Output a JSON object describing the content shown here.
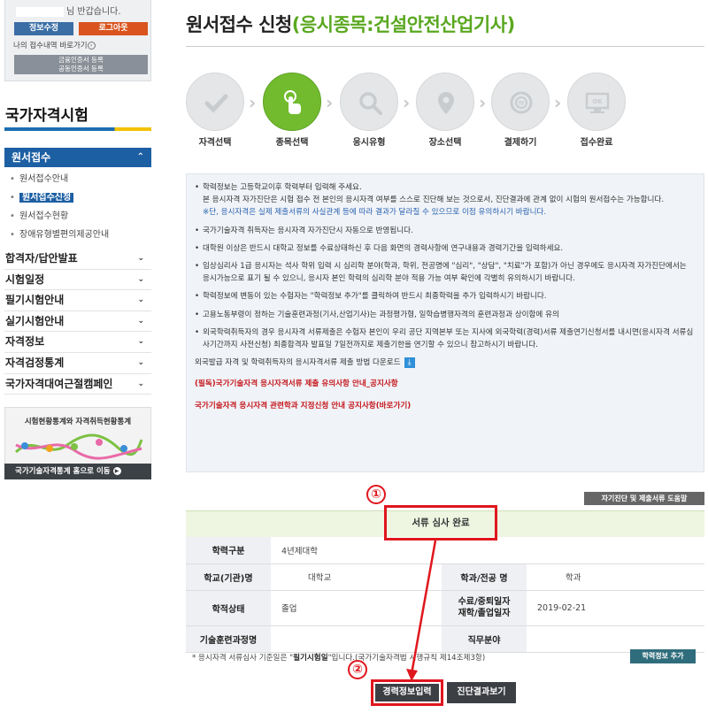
{
  "sidebar": {
    "welcome": "님 반갑습니다.",
    "info_btn": "정보수정",
    "logout_btn": "로그아웃",
    "history_link": "나의 접수내역 바로가기",
    "cert_line1": "금융인증서 등록",
    "cert_line2": "공동인증서 등록",
    "section_title": "국가자격시험",
    "active_menu": "원서접수",
    "submenu": [
      {
        "label": "원서접수안내"
      },
      {
        "label": "원서접수신청"
      },
      {
        "label": "원서접수현황"
      },
      {
        "label": "장애유형별편의제공안내"
      }
    ],
    "menus": [
      {
        "label": "합격자/답안발표"
      },
      {
        "label": "시험일정"
      },
      {
        "label": "필기시험안내"
      },
      {
        "label": "실기시험안내"
      },
      {
        "label": "자격정보"
      },
      {
        "label": "자격검정통계"
      },
      {
        "label": "국가자격대여근절캠페인"
      }
    ],
    "stat_title": "시험현황통계와 자격취득현황통계",
    "stat_link": "국가기술자격통계 홈으로 이동"
  },
  "main": {
    "title": "원서접수 신청",
    "title_sub": "(응시종목:건설안전산업기사)",
    "steps": [
      {
        "label": "자격선택",
        "icon": "check-icon"
      },
      {
        "label": "종목선택",
        "icon": "hand-pointer-icon"
      },
      {
        "label": "응시유형",
        "icon": "magnifier-icon"
      },
      {
        "label": "장소선택",
        "icon": "map-pin-icon"
      },
      {
        "label": "결제하기",
        "icon": "payment-icon"
      },
      {
        "label": "접수완료",
        "icon": "ok-monitor-icon"
      }
    ],
    "notice": {
      "item1_a": "학력정보는 고등학교이후 학력부터 입력해 주세요.",
      "item1_b": "본 응시자격 자가진단은 시험 접수 전 본인의 응시자격 여부를 스스로 진단해 보는 것으로서, 진단결과에 관계 없이 시험의 원서접수는 가능합니다.",
      "item1_c": "※단, 응시자격은 실제 제출서류의 사실관계 등에 따라 결과가 달라질 수 있으므로 이점 유의하시기 바랍니다.",
      "item2": "국가기술자격 취득자는 응시자격 자가진단시 자동으로 반영됩니다.",
      "item3": "대학원 이상은 반드시 대학교 정보를 수료상태하신 후 다음 화면의 경력사항에 연구내용과 경력기간을 입력하세요.",
      "item4": "임상심리사 1급 응시자는 석사 학위 입력 시 심리학 분야(학과, 학위, 전공명에 \"심리\", \"상담\", \"치료\"가 포함)가 아닌 경우에도 응시자격 자가진단에서는 응시가능으로 표기 될 수 있으니, 응시자 본인 학력의 심리학 분야 적용 가능 여부 확인에 각별히 유의하시기 바랍니다.",
      "item5": "학력정보에 변동이 있는 수험자는 \"학력정보 추가\"를 클릭하여 반드시 최종학력을 추가 입력하시기 바랍니다.",
      "item6": "고용노동부령이 정하는 기술훈련과정(기사,산업기사)는 과정평가형, 일학습병행자격의 훈련과정과 상이함에 유의",
      "item7": "외국학력취득자의 경우 응시자격 서류제출은 수험자 본인이 우리 공단 지역본부 또는 지사에 외국학력(경력)서류 제출연기신청서를 내시면(응시자격 서류심사기간까지 사전신청) 최종합격자 발표일 7일전까지로 제출기한을 연기할 수 있으니 참고하시기 바랍니다.",
      "download": "외국발급 자격 및 학력취득자의 응시자격서류 제출 방법 다운로드",
      "red1": "(필독)국가기술자격 응시자격서류 제출 유의사항 안내_공지사항",
      "red2": "국가기술자격 응시자격 관련학과 지정신청 안내 공지사항(바로가기)"
    },
    "help_btn": "자기진단 및 제출서류 도움말",
    "review_status": "서류 심사 완료",
    "marker1": "①",
    "marker2": "②",
    "table": {
      "edu_type_h": "학력구분",
      "edu_type_v": "4년제대학",
      "school_h": "학교(기관)명",
      "school_v": "대학교",
      "major_h": "학과/전공 명",
      "major_v": "학과",
      "status_h": "학적상태",
      "status_v": "졸업",
      "date_h1": "수료/중퇴일자",
      "date_h2": "재학/졸업일자",
      "date_v": "2019-02-21",
      "course_h": "기술훈련과정명",
      "course_v": "",
      "job_h": "직무분야",
      "job_v": ""
    },
    "footnote_a": "* 응시자격 서류심사 기준일은 \"",
    "footnote_b": "필기시험일",
    "footnote_c": "\"입니다.(국가기술자격법 시행규칙 제14조제3항)",
    "add_btn": "학력정보 추가",
    "career_btn": "경력정보입력",
    "diag_btn": "진단결과보기"
  }
}
